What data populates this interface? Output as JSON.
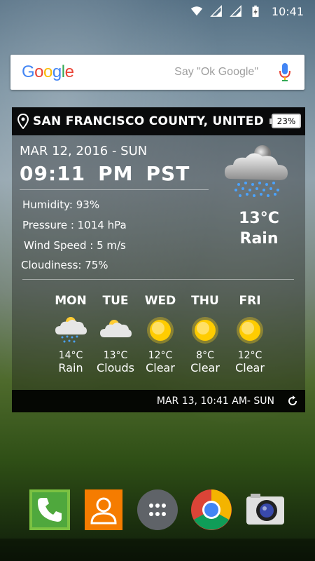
{
  "status_bar": {
    "time": "10:41",
    "icons": [
      "wifi-icon",
      "signal-icon",
      "signal-icon",
      "battery-charging-icon"
    ]
  },
  "search_bar": {
    "logo_letters": [
      "G",
      "o",
      "o",
      "g",
      "l",
      "e"
    ],
    "placeholder": "Say \"Ok Google\"",
    "mic_icon": "mic-icon"
  },
  "widget": {
    "location": "SAN FRANCISCO COUNTY, UNITED",
    "battery": "23%",
    "date": "MAR 12, 2016 - SUN",
    "time_parts": [
      "09:11",
      "PM",
      "PST"
    ],
    "details": [
      "Humidity: 93%",
      "Pressure : 1014 hPa",
      "Wind Speed : 5  m/s",
      "Cloudiness: 75%"
    ],
    "current": {
      "temp": "13°C",
      "condition": "Rain",
      "icon": "night-rain-cloud-icon"
    },
    "forecast": [
      {
        "day": "MON",
        "temp": "14°C",
        "condition": "Rain",
        "icon": "rain-cloud-icon"
      },
      {
        "day": "TUE",
        "temp": "13°C",
        "condition": "Clouds",
        "icon": "cloud-icon"
      },
      {
        "day": "WED",
        "temp": "12°C",
        "condition": "Clear",
        "icon": "sun-icon"
      },
      {
        "day": "THU",
        "temp": "8°C",
        "condition": "Clear",
        "icon": "sun-icon"
      },
      {
        "day": "FRI",
        "temp": "12°C",
        "condition": "Clear",
        "icon": "sun-icon"
      }
    ],
    "updated": "MAR 13, 10:41 AM- SUN"
  },
  "dock": {
    "apps": [
      {
        "name": "Phone",
        "icon": "phone-icon",
        "color": "#4caf50"
      },
      {
        "name": "Contacts",
        "icon": "contacts-icon",
        "color": "#ff8f00"
      },
      {
        "name": "Apps",
        "icon": "app-drawer-icon",
        "color": "#616161"
      },
      {
        "name": "Chrome",
        "icon": "chrome-icon",
        "color": "#db4437"
      },
      {
        "name": "Camera",
        "icon": "camera-icon",
        "color": "#e0e0e0"
      }
    ]
  },
  "colors": {
    "widget_header_bg": "#000000",
    "text": "#ffffff",
    "sun": "#ffcc00"
  }
}
